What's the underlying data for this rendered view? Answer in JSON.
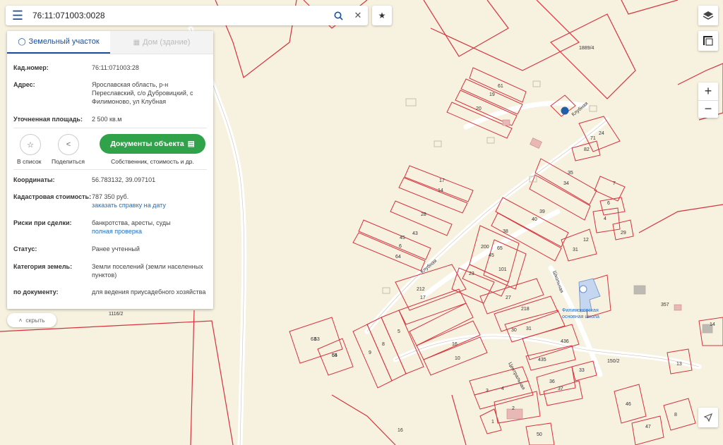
{
  "search": {
    "value": "76:11:071003:0028"
  },
  "panel": {
    "tabs": [
      {
        "label": "Земельный участок"
      },
      {
        "label": "Дом (здание)"
      }
    ],
    "cadastral_number": {
      "label": "Кад.номер:",
      "value": "76:11:071003:28"
    },
    "address": {
      "label": "Адрес:",
      "value": "Ярославская область, р-н Переславский, с/о Дубровицкий, с Филимоново, ул Клубная"
    },
    "area": {
      "label": "Уточненная площадь:",
      "value": "2 500 кв.м"
    },
    "actions": {
      "list_label": "В список",
      "share_label": "Поделиться",
      "docs_label": "Документы объекта",
      "docs_sub": "Собственник, стоимость и др."
    },
    "coordinates": {
      "label": "Координаты:",
      "value": "56.783132, 39.097101"
    },
    "cad_value": {
      "label": "Кадастровая стоимость:",
      "value": "787 350 руб.",
      "link": "заказать справку на дату"
    },
    "risks": {
      "label": "Риски при сделки:",
      "value": "банкротства, аресты, суды",
      "link": "полная проверка"
    },
    "status": {
      "label": "Статус:",
      "value": "Ранее учтенный"
    },
    "land_category": {
      "label": "Категория земель:",
      "value": "Земли поселений (земли населенных пунктов)"
    },
    "by_document": {
      "label": "по документу:",
      "value": "для ведения приусадебного хозяйства"
    }
  },
  "hide_label": "скрыть",
  "map": {
    "parcel_labels": [
      "61",
      "19",
      "20",
      "24",
      "71",
      "82",
      "17",
      "14",
      "28",
      "43",
      "45",
      "6",
      "64",
      "35",
      "34",
      "7",
      "6",
      "4",
      "29",
      "39",
      "40",
      "38",
      "65",
      "101",
      "200",
      "45",
      "23",
      "212",
      "17",
      "27",
      "218",
      "30",
      "31",
      "436",
      "435",
      "3",
      "4",
      "2",
      "36",
      "37",
      "33",
      "16",
      "10",
      "5",
      "8",
      "9",
      "63",
      "64",
      "357",
      "13",
      "14",
      "46",
      "47",
      "8",
      "50",
      "1",
      "16",
      "12",
      "31",
      "150/2",
      "1889/4",
      "1116/2",
      "63",
      "55"
    ],
    "street_labels": [
      "Клубная",
      "Клубная",
      "Центральная",
      "Школьная"
    ],
    "poi_label": "Филимоновская основная школа"
  },
  "colors": {
    "parcel": "#d6333d",
    "road": "#ffffff",
    "background": "#f7f1e0",
    "accent": "#1a4fa0",
    "button": "#2fa24a"
  }
}
